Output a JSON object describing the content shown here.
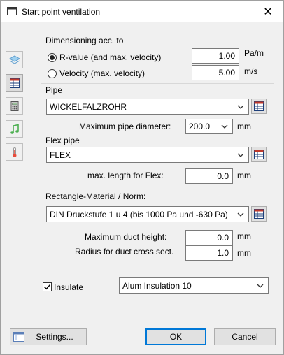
{
  "window": {
    "title": "Start point ventilation",
    "close": "✕"
  },
  "dimensioning": {
    "label": "Dimensioning acc. to",
    "rvalue_label": "R-value (and max. velocity)",
    "rvalue_value": "1.00",
    "rvalue_unit": "Pa/m",
    "velocity_label": "Velocity (max. velocity)",
    "velocity_value": "5.00",
    "velocity_unit": "m/s"
  },
  "pipe": {
    "label": "Pipe",
    "type": "WICKELFALZROHR",
    "max_diameter_label": "Maximum pipe diameter:",
    "max_diameter_value": "200.0",
    "max_diameter_unit": "mm"
  },
  "flex": {
    "label": "Flex pipe",
    "type": "FLEX",
    "max_length_label": "max. length for Flex:",
    "max_length_value": "0.0",
    "max_length_unit": "mm"
  },
  "rect": {
    "label": "Rectangle-Material / Norm:",
    "type": "DIN Druckstufe 1 u 4 (bis 1000 Pa und -630 Pa)",
    "max_height_label": "Maximum duct height:",
    "max_height_value": "0.0",
    "max_height_unit": "mm",
    "radius_label": "Radius for duct cross sect.",
    "radius_value": "1.0",
    "radius_unit": "mm"
  },
  "insulate": {
    "label": "Insulate",
    "checked": true,
    "material": "Alum Insulation 10"
  },
  "buttons": {
    "settings": "Settings...",
    "ok": "OK",
    "cancel": "Cancel"
  }
}
